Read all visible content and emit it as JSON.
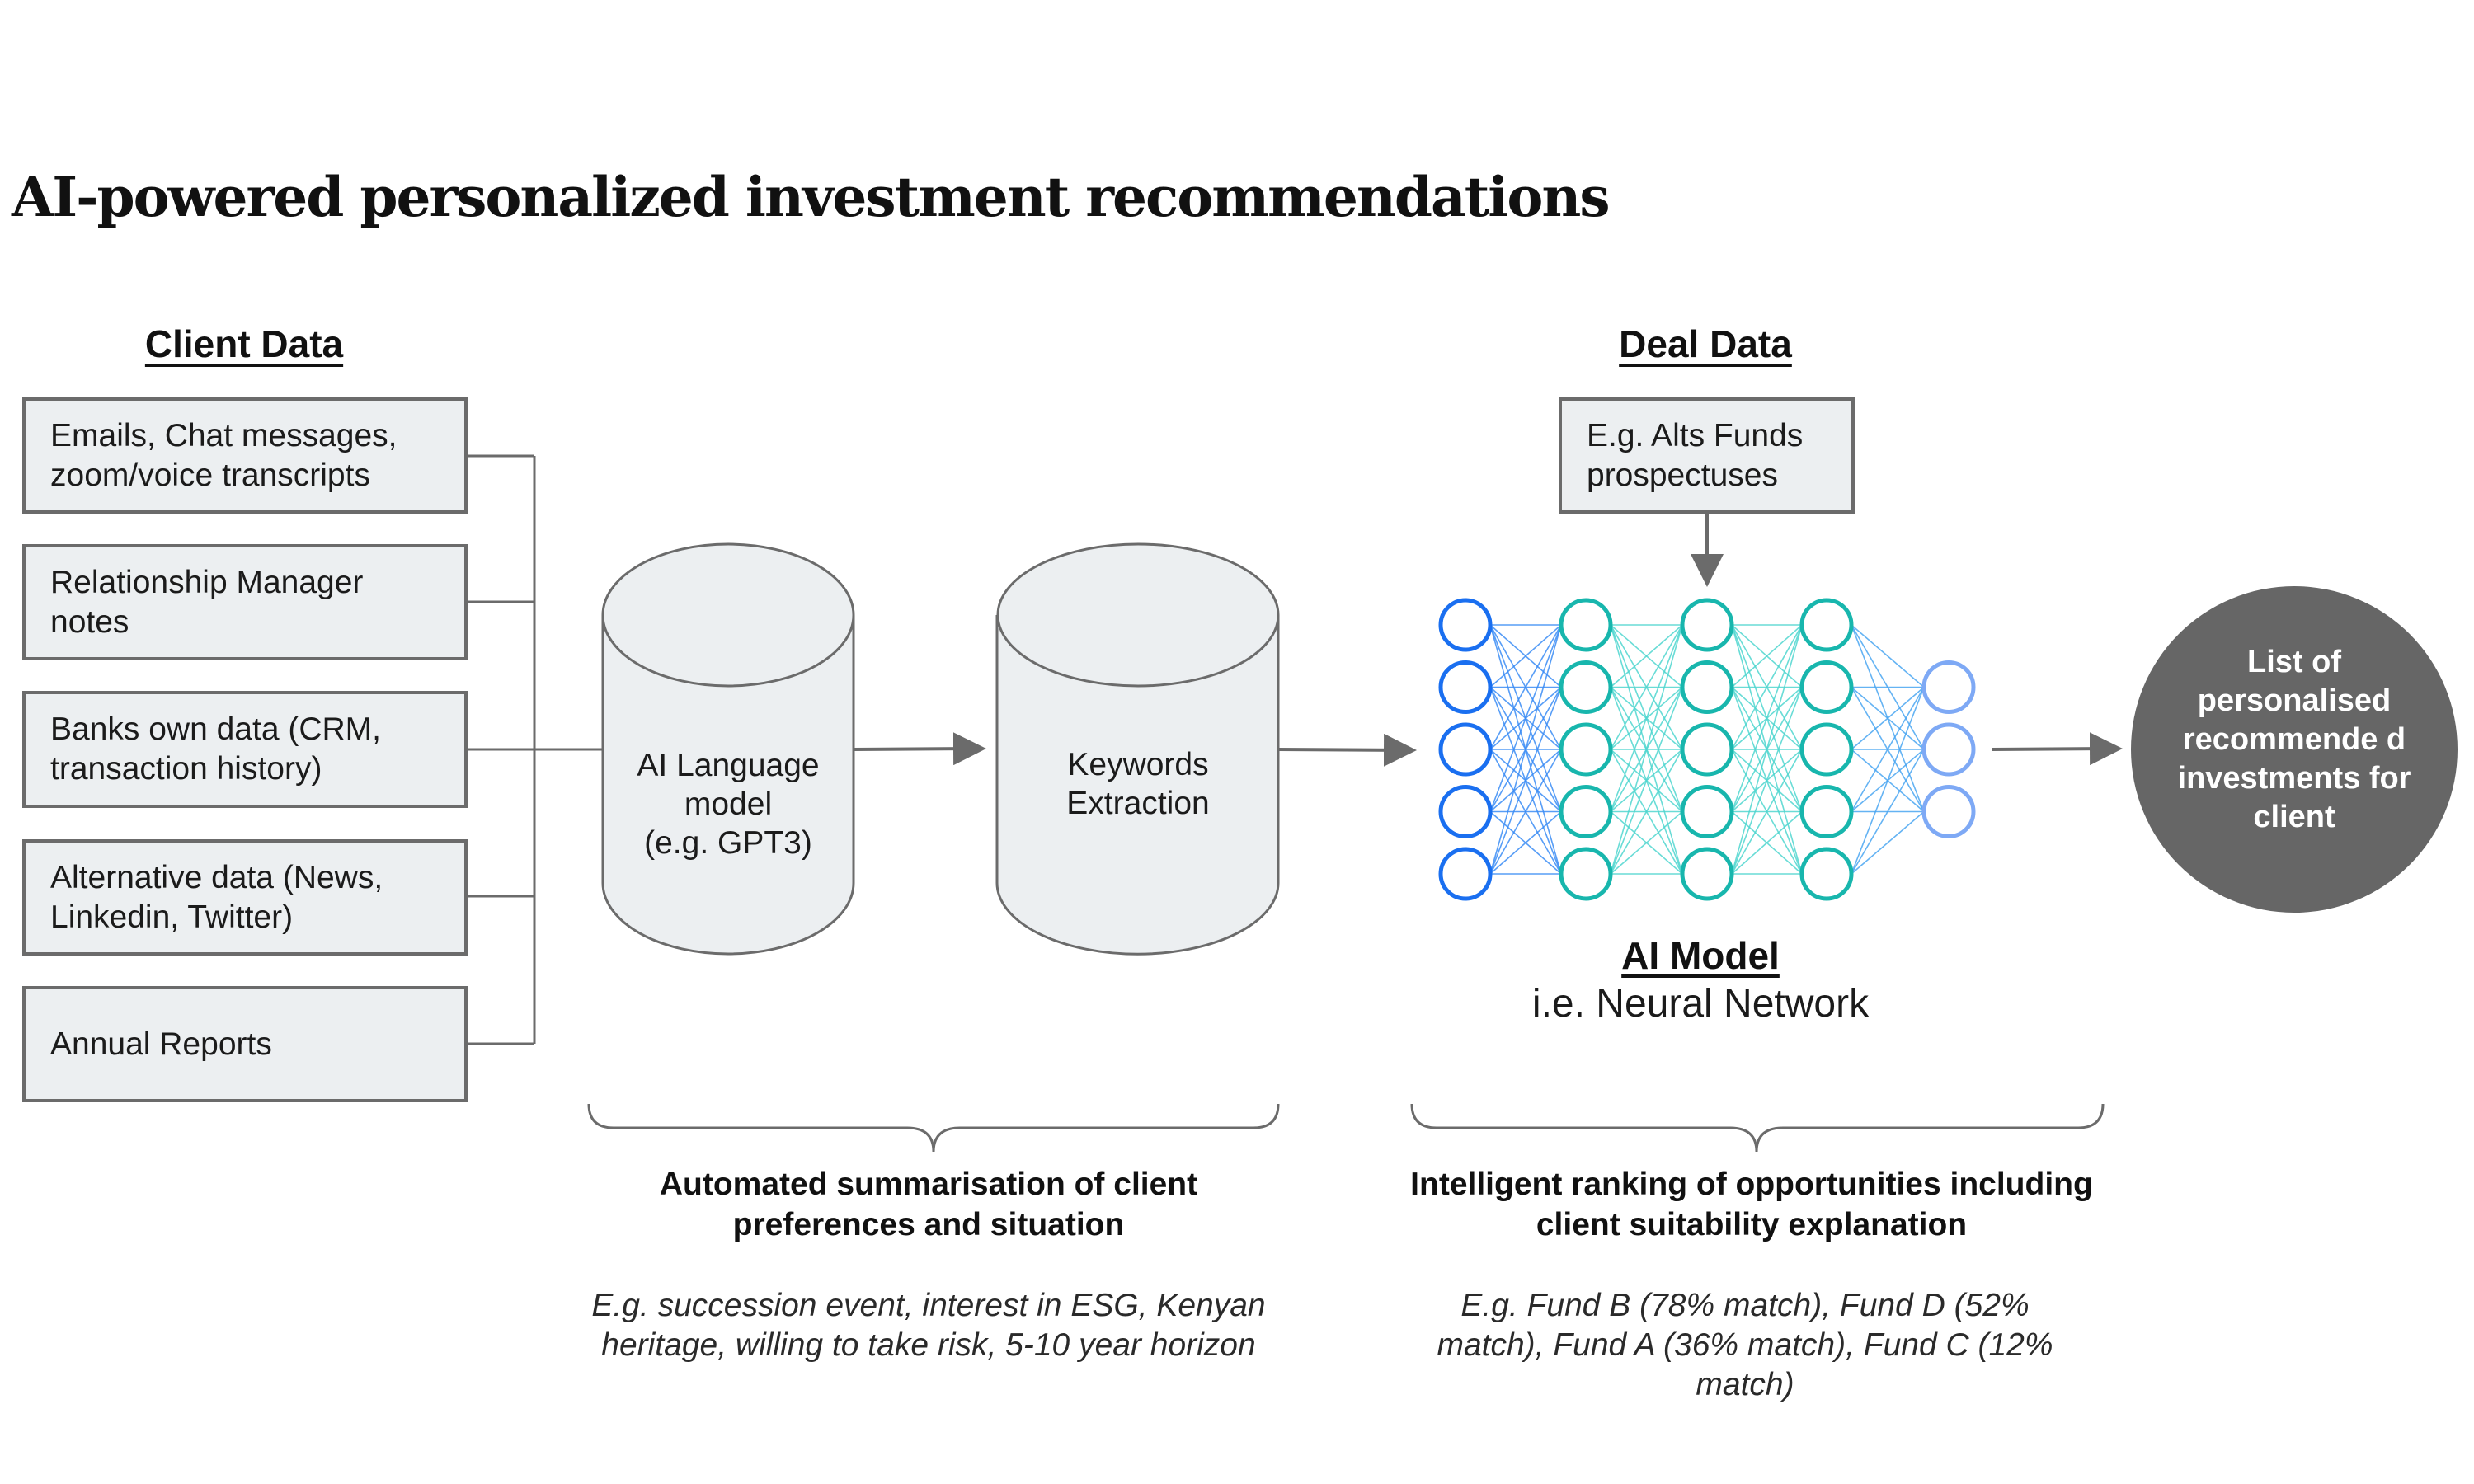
{
  "title": "AI-powered personalized investment recommendations",
  "client_data": {
    "heading": "Client Data",
    "sources": [
      {
        "label": "Emails, Chat messages, zoom/voice transcripts"
      },
      {
        "label": "Relationship Manager notes"
      },
      {
        "label": "Banks own data (CRM, transaction history)"
      },
      {
        "label": "Alternative data (News, Linkedin, Twitter)"
      },
      {
        "label": "Annual Reports"
      }
    ]
  },
  "pipeline": {
    "language_model": {
      "line1": "AI Language",
      "line2": "model",
      "line3": "(e.g. GPT3)"
    },
    "keywords": {
      "line1": "Keywords",
      "line2": "Extraction"
    }
  },
  "deal_data": {
    "heading": "Deal Data",
    "box_label": "E.g. Alts Funds prospectuses"
  },
  "ai_model": {
    "title": "AI Model",
    "subtitle": "i.e. Neural Network",
    "layers": [
      5,
      5,
      5,
      5,
      3
    ]
  },
  "result": {
    "label": "List of personalised recommende d investments for client"
  },
  "summaries": {
    "left": {
      "heading": "Automated summarisation of client preferences and situation",
      "example": "E.g. succession event,  interest in ESG, Kenyan heritage, willing to take risk, 5-10 year horizon"
    },
    "right": {
      "heading": "Intelligent ranking of opportunities including client suitability explanation",
      "example": "E.g. Fund B (78% match), Fund D (52% match), Fund A (36% match), Fund C (12% match)"
    }
  },
  "colors": {
    "box_fill": "#eceff1",
    "box_stroke": "#6b6b6b",
    "connector": "#6b6b6b",
    "result_circle": "#666666",
    "nn_input": "#1a6ff0",
    "nn_hidden": "#18b6ad",
    "nn_output": "#7ea9f5"
  }
}
